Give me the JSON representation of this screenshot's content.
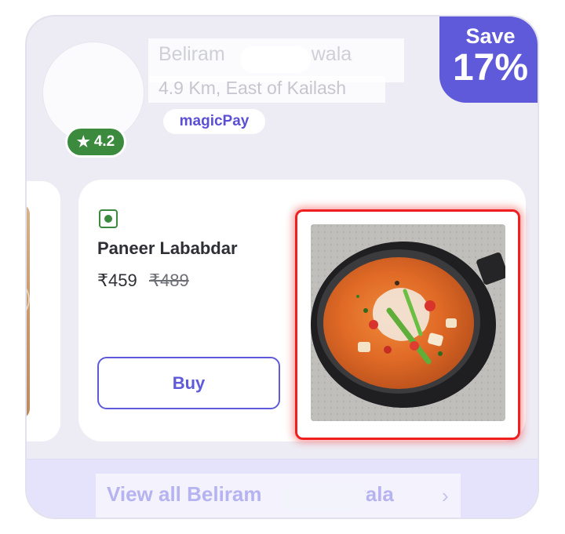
{
  "store": {
    "name": "Beliram",
    "name_suffix": "wala",
    "location": "4.9 Km, East of Kailash",
    "rating": "4.2",
    "rating_icon": "star-icon",
    "payment_badge": "magicPay"
  },
  "discount": {
    "label": "Save",
    "value": "17%"
  },
  "item": {
    "veg_indicator": "veg-icon",
    "name": "Paneer Lababdar",
    "price": "₹459",
    "original_price": "₹489",
    "buy_label": "Buy",
    "image_alt": "Paneer Lababdar in black bowl"
  },
  "footer": {
    "view_all_prefix": "View all Beliram",
    "view_all_suffix": "wala",
    "chevron": "chevron-right-icon"
  },
  "colors": {
    "accent": "#5e5ad9",
    "veg_green": "#3b8a3e",
    "highlight_red": "#ef1f1f"
  }
}
